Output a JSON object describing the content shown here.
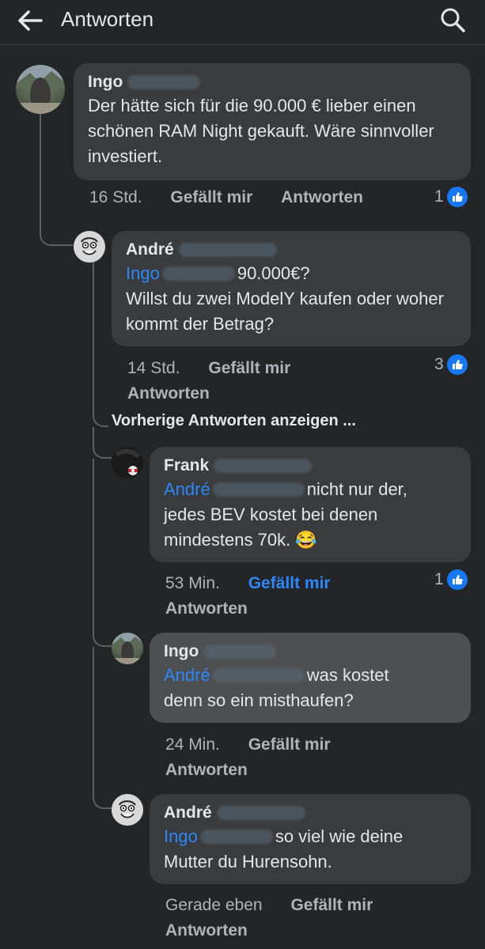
{
  "header": {
    "title": "Antworten"
  },
  "icons": {
    "back": "arrow-left-icon",
    "search": "search-icon",
    "like": "thumbs-up-icon"
  },
  "colors": {
    "background": "#242526",
    "bubble": "#3a3b3c",
    "bubble_highlight": "#4e4f50",
    "link": "#2d88ff",
    "meta": "#b0b3b8"
  },
  "comments": [
    {
      "author": "Ingo",
      "text": "Der hätte sich für die 90.000 € lieber einen schönen RAM Night gekauft. Wäre sinnvoller investiert.",
      "time": "16 Std.",
      "like_label": "Gefällt mir",
      "reply_label": "Antworten",
      "reactions": "1"
    },
    {
      "author": "André",
      "mention": "Ingo",
      "text": "90.000€?",
      "text2": "Willst du zwei ModelY kaufen oder woher kommt der Betrag?",
      "time": "14 Std.",
      "like_label": "Gefällt mir",
      "reply_label": "Antworten",
      "reactions": "3"
    },
    {
      "author": "Frank",
      "mention": "André",
      "text": "nicht nur der,",
      "text2": "jedes BEV kostet bei denen mindestens 70k. 😂",
      "time": "53 Min.",
      "like_label": "Gefällt mir",
      "reply_label": "Antworten",
      "reactions": "1"
    },
    {
      "author": "Ingo",
      "mention": "André",
      "text": "was kostet",
      "text2": "denn so ein misthaufen?",
      "time": "24 Min.",
      "like_label": "Gefällt mir",
      "reply_label": "Antworten"
    },
    {
      "author": "André",
      "mention": "Ingo",
      "text": "so viel wie deine",
      "text2": "Mutter du Hurensohn.",
      "time": "Gerade eben",
      "like_label": "Gefällt mir",
      "reply_label": "Antworten"
    }
  ],
  "previous_replies_label": "Vorherige Antworten anzeigen ..."
}
